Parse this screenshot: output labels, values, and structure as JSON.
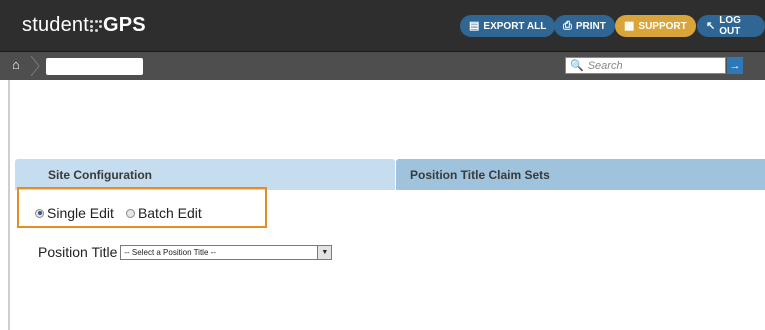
{
  "app": {
    "logo_prefix": "student",
    "logo_suffix": "GPS"
  },
  "topbar": {
    "export_label": "EXPORT ALL",
    "export_icon": "export-icon",
    "print_label": "PRINT",
    "print_icon": "printer-icon",
    "support_label": "SUPPORT",
    "support_icon": "support-icon",
    "logout_label": "LOG OUT",
    "logout_icon": "logout-arrow-icon"
  },
  "navbar": {
    "home_icon": "home-icon",
    "breadcrumb_value": "",
    "search_placeholder": "Search",
    "search_value": "",
    "go_icon": "arrow-right-icon"
  },
  "tabs": [
    {
      "label": "Site Configuration",
      "active": true
    },
    {
      "label": "Position Title Claim Sets",
      "active": false
    }
  ],
  "edit_mode": {
    "options": [
      {
        "label": "Single Edit",
        "selected": true
      },
      {
        "label": "Batch Edit",
        "selected": false
      }
    ]
  },
  "position_title": {
    "label": "Position Title",
    "selected_option": "-- Select a Position Title --"
  },
  "colors": {
    "topbar_bg": "#2e2e2e",
    "navbar_bg": "#4e4e4e",
    "button_blue": "#2f6694",
    "button_gold": "#d9a53b",
    "tab_active_bg": "#c5ddee",
    "tab_inactive_bg": "#9fc2dd",
    "highlight_border": "#e88c1f"
  }
}
